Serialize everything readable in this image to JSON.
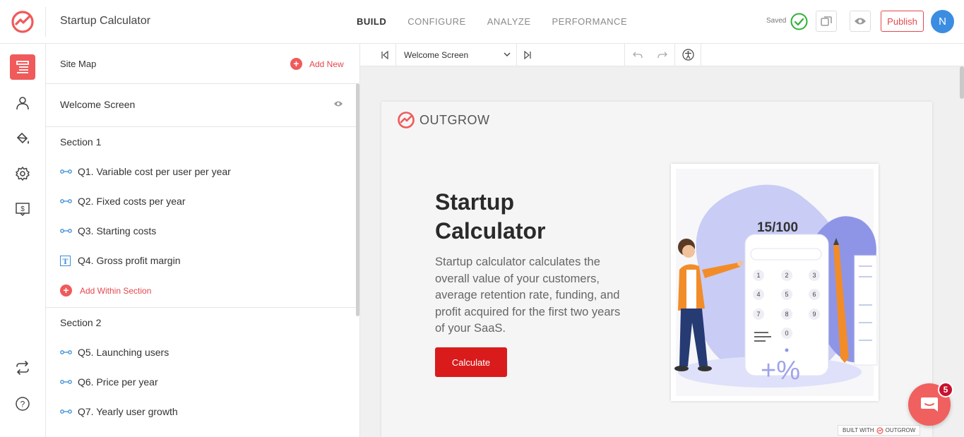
{
  "header": {
    "app_title": "Startup Calculator",
    "nav": [
      "BUILD",
      "CONFIGURE",
      "ANALYZE",
      "PERFORMANCE"
    ],
    "active_nav": "BUILD",
    "saved_label": "Saved",
    "publish_label": "Publish",
    "avatar_initial": "N"
  },
  "sitemap": {
    "title": "Site Map",
    "add_new_label": "Add New",
    "welcome_screen": "Welcome Screen",
    "section1": {
      "title": "Section 1",
      "questions": [
        "Q1. Variable cost per user per year",
        "Q2. Fixed costs per year",
        "Q3. Starting costs",
        "Q4. Gross profit margin"
      ],
      "add_within_label": "Add Within Section"
    },
    "section2": {
      "title": "Section 2",
      "questions": [
        "Q5. Launching users",
        "Q6. Price per year",
        "Q7. Yearly user growth"
      ]
    }
  },
  "toolbar": {
    "current_screen": "Welcome Screen"
  },
  "preview": {
    "brand": "OUTGROW",
    "title_line1": "Startup",
    "title_line2": "Calculator",
    "description": "Startup calculator calculates the overall value of your customers, average retention rate, funding, and profit acquired for the first two years of your SaaS.",
    "cta_label": "Calculate",
    "score_text": "15/100",
    "keypad": [
      "1",
      "2",
      "3",
      "4",
      "5",
      "6",
      "7",
      "8",
      "9",
      "0"
    ],
    "built_with": "BUILT WITH",
    "built_brand": "OUTGROW"
  },
  "chat": {
    "badge_count": "5"
  },
  "colors": {
    "accent": "#f05a5a",
    "cta": "#d91b1b",
    "avatar": "#3b8de1",
    "saved_check": "#2eb135"
  }
}
